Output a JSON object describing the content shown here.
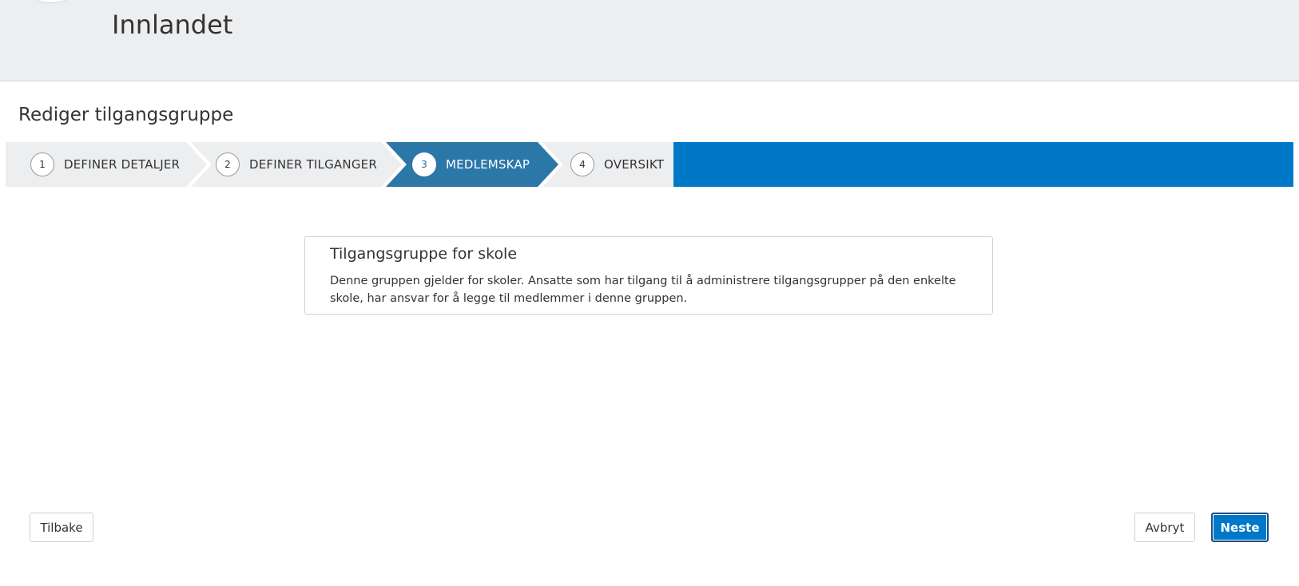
{
  "header": {
    "org_name": "Innlandet"
  },
  "page": {
    "title": "Rediger tilgangsgruppe"
  },
  "stepper": {
    "active_step": 3,
    "colors": {
      "inactive": "#edeef0",
      "active": "#2b77a8",
      "fill": "#0078c8"
    },
    "steps": [
      {
        "number": "1",
        "label": "DEFINER DETALJER"
      },
      {
        "number": "2",
        "label": "DEFINER TILGANGER"
      },
      {
        "number": "3",
        "label": "MEDLEMSKAP"
      },
      {
        "number": "4",
        "label": "OVERSIKT"
      }
    ]
  },
  "info_card": {
    "title": "Tilgangsgruppe for skole",
    "text": "Denne gruppen gjelder for skoler. Ansatte som har tilgang til å administrere tilgangsgrupper på den enkelte skole, har ansvar for å legge til medlemmer i denne gruppen."
  },
  "footer": {
    "back_label": "Tilbake",
    "cancel_label": "Avbryt",
    "next_label": "Neste"
  }
}
